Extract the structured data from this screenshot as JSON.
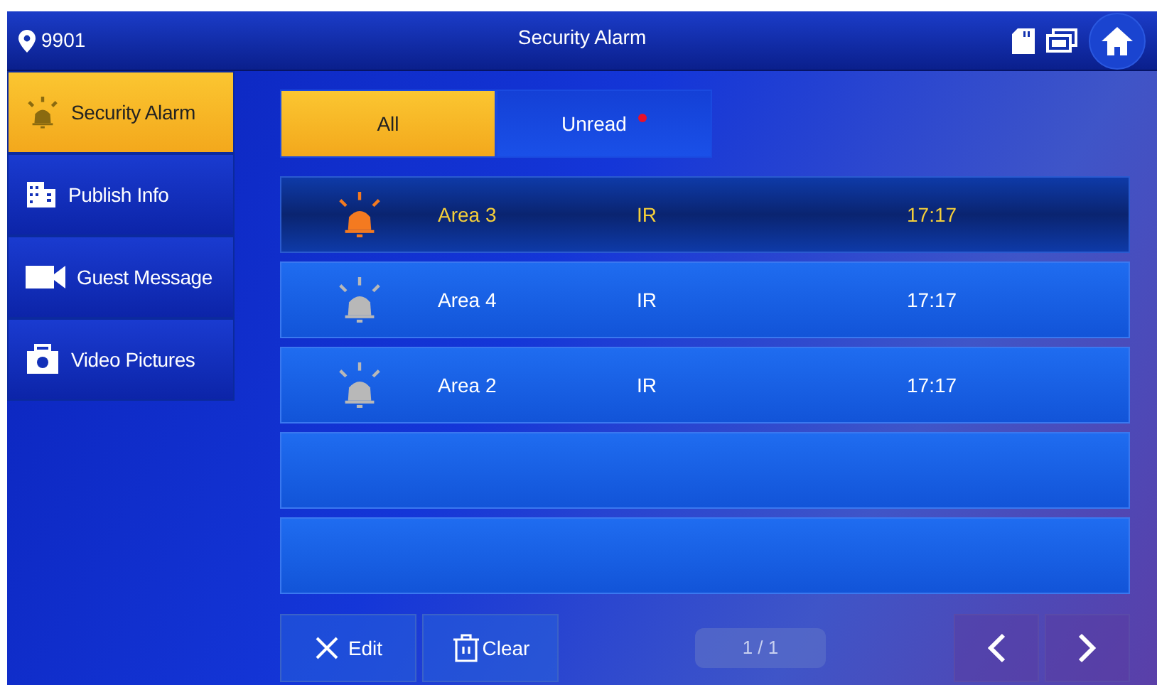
{
  "header": {
    "room": "9901",
    "title": "Security Alarm"
  },
  "sidebar": {
    "items": [
      {
        "label": "Security Alarm",
        "kind": "bell",
        "selected": true
      },
      {
        "label": "Publish Info",
        "kind": "building",
        "selected": false
      },
      {
        "label": "Guest Message",
        "kind": "camcorder",
        "selected": false
      },
      {
        "label": "Video Pictures",
        "kind": "camera",
        "selected": false
      }
    ]
  },
  "tabs": [
    {
      "label": "All",
      "selected": true,
      "dot": false
    },
    {
      "label": "Unread",
      "selected": false,
      "dot": true
    }
  ],
  "rows": [
    {
      "kind": "alarm",
      "area": "Area 3",
      "type": "IR",
      "time": "17:17",
      "selected": true,
      "unread": true
    },
    {
      "kind": "alarm",
      "area": "Area 4",
      "type": "IR",
      "time": "17:17",
      "selected": false,
      "unread": false
    },
    {
      "kind": "alarm",
      "area": "Area 2",
      "type": "IR",
      "time": "17:17",
      "selected": false,
      "unread": false
    },
    {
      "kind": "empty"
    },
    {
      "kind": "empty"
    }
  ],
  "toolbar": {
    "edit": "Edit",
    "clear": "Clear",
    "page": "1 / 1"
  }
}
